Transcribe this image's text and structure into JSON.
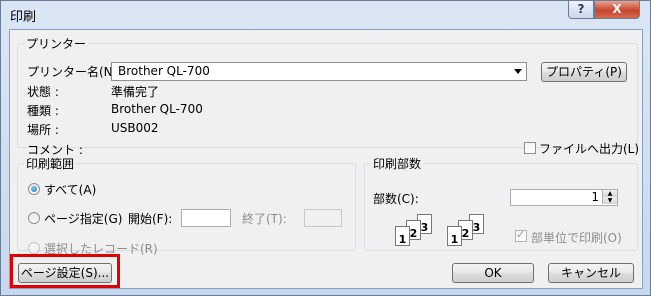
{
  "window": {
    "title": "印刷",
    "help_label": "?",
    "close_label": "X"
  },
  "printer": {
    "group_label": "プリンター",
    "name_label": "プリンター名(N):",
    "name_value": "Brother QL-700",
    "properties_button": "プロパティ(P)",
    "status_label": "状態 :",
    "status_value": "準備完了",
    "type_label": "種類 :",
    "type_value": "Brother QL-700",
    "location_label": "場所 :",
    "location_value": "USB002",
    "comment_label": "コメント :",
    "print_to_file_label": "ファイルへ出力(L)"
  },
  "range": {
    "group_label": "印刷範囲",
    "all_label": "すべて(A)",
    "pages_label": "ページ指定(G)",
    "from_label": "開始(F):",
    "to_label": "終了(T):",
    "selection_label": "選択したレコード(R)"
  },
  "copies": {
    "group_label": "印刷部数",
    "count_label": "部数(C):",
    "count_value": "1",
    "collate_label": "部単位で印刷(O)",
    "collate_icon_digits": [
      "1",
      "2",
      "3"
    ]
  },
  "footer": {
    "page_setup_button": "ページ設定(S)...",
    "ok_button": "OK",
    "cancel_button": "キャンセル"
  }
}
